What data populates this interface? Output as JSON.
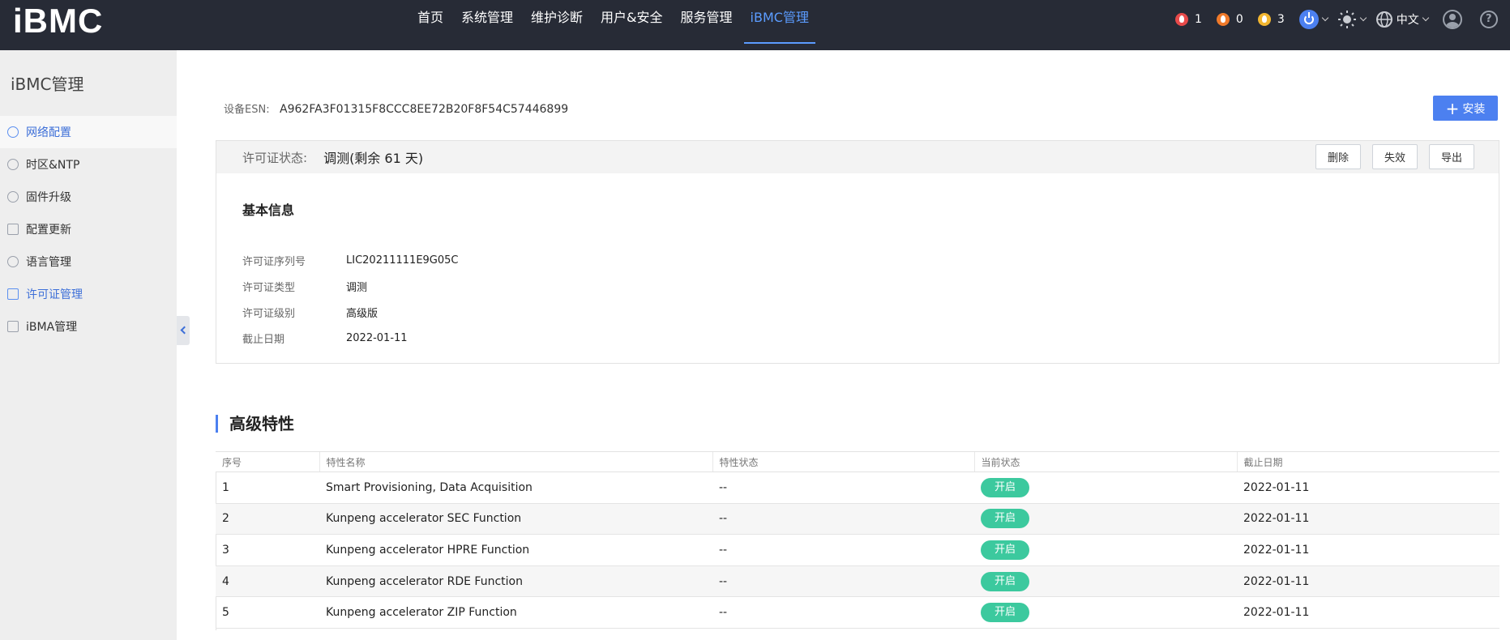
{
  "header": {
    "logo": "iBMC",
    "nav": [
      {
        "label": "首页",
        "active": false
      },
      {
        "label": "系统管理",
        "active": false
      },
      {
        "label": "维护诊断",
        "active": false
      },
      {
        "label": "用户&安全",
        "active": false
      },
      {
        "label": "服务管理",
        "active": false
      },
      {
        "label": "iBMC管理",
        "active": true
      }
    ],
    "alarms": {
      "critical": "1",
      "major": "0",
      "minor": "3"
    },
    "language": "中文",
    "help": "?"
  },
  "sidebar": {
    "title": "iBMC管理",
    "items": [
      {
        "label": "网络配置",
        "icon": "globe-icon",
        "state": "hover"
      },
      {
        "label": "时区&NTP",
        "icon": "clock-icon",
        "state": ""
      },
      {
        "label": "固件升级",
        "icon": "upgrade-icon",
        "state": ""
      },
      {
        "label": "配置更新",
        "icon": "config-icon",
        "state": ""
      },
      {
        "label": "语言管理",
        "icon": "language-icon",
        "state": ""
      },
      {
        "label": "许可证管理",
        "icon": "license-icon",
        "state": "selected"
      },
      {
        "label": "iBMA管理",
        "icon": "ibma-icon",
        "state": ""
      }
    ]
  },
  "main": {
    "esn_label": "设备ESN:",
    "esn_value": "A962FA3F01315F8CCC8EE72B20F8F54C57446899",
    "install_label": "安装",
    "license": {
      "status_label": "许可证状态:",
      "status_value": "调测(剩余 61 天)",
      "buttons": {
        "delete": "删除",
        "invalidate": "失效",
        "export": "导出"
      },
      "basic_title": "基本信息",
      "info": [
        {
          "key": "许可证序列号",
          "value": "LIC20211111E9G05C"
        },
        {
          "key": "许可证类型",
          "value": "调测"
        },
        {
          "key": "许可证级别",
          "value": "高级版"
        },
        {
          "key": "截止日期",
          "value": "2022-01-11"
        }
      ]
    },
    "advanced_title": "高级特性",
    "table": {
      "headers": [
        "序号",
        "特性名称",
        "特性状态",
        "当前状态",
        "截止日期"
      ],
      "rows": [
        {
          "no": "1",
          "name": "Smart Provisioning, Data Acquisition",
          "status": "--",
          "current": "开启",
          "date": "2022-01-11"
        },
        {
          "no": "2",
          "name": "Kunpeng accelerator SEC Function",
          "status": "--",
          "current": "开启",
          "date": "2022-01-11"
        },
        {
          "no": "3",
          "name": "Kunpeng accelerator HPRE Function",
          "status": "--",
          "current": "开启",
          "date": "2022-01-11"
        },
        {
          "no": "4",
          "name": "Kunpeng accelerator RDE Function",
          "status": "--",
          "current": "开启",
          "date": "2022-01-11"
        },
        {
          "no": "5",
          "name": "Kunpeng accelerator ZIP Function",
          "status": "--",
          "current": "开启",
          "date": "2022-01-11"
        }
      ]
    }
  },
  "colors": {
    "topbar": "#272b36",
    "accent": "#4c80f0",
    "active_nav": "#5b9cff",
    "status_on": "#3cc99e",
    "alarm_critical": "#e84a4a",
    "alarm_major": "#f07a2a",
    "alarm_minor": "#f2b630"
  }
}
